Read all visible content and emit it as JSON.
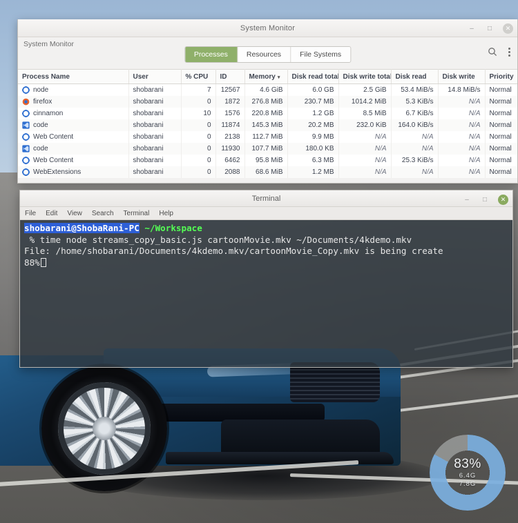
{
  "desktop": {
    "wallpaper_description": "blue-sports-car-on-asphalt"
  },
  "system_monitor": {
    "window_title": "System Monitor",
    "app_name": "System Monitor",
    "window_controls": {
      "minimize": "–",
      "maximize": "□",
      "close": "✕"
    },
    "tabs": [
      {
        "label": "Processes",
        "active": true
      },
      {
        "label": "Resources",
        "active": false
      },
      {
        "label": "File Systems",
        "active": false
      }
    ],
    "actions": {
      "search": "search-icon",
      "menu": "kebab-menu-icon"
    },
    "columns": [
      "Process Name",
      "User",
      "% CPU",
      "ID",
      "Memory",
      "Disk read total",
      "Disk write total",
      "Disk read",
      "Disk write",
      "Priority"
    ],
    "sorted_column": "Memory",
    "sort_caret": "▾",
    "rows": [
      {
        "name": "node",
        "icon": "gear-icon",
        "user": "shobarani",
        "cpu": "7",
        "id": "12567",
        "memory": "4.6 GiB",
        "disk_read_total": "6.0 GB",
        "disk_write_total": "2.5 GiB",
        "disk_read": "53.4 MiB/s",
        "disk_write": "14.8 MiB/s",
        "priority": "Normal"
      },
      {
        "name": "firefox",
        "icon": "firefox-icon",
        "user": "shobarani",
        "cpu": "0",
        "id": "1872",
        "memory": "276.8 MiB",
        "disk_read_total": "230.7 MB",
        "disk_write_total": "1014.2 MiB",
        "disk_read": "5.3 KiB/s",
        "disk_write": "N/A",
        "priority": "Normal"
      },
      {
        "name": "cinnamon",
        "icon": "gear-icon",
        "user": "shobarani",
        "cpu": "10",
        "id": "1576",
        "memory": "220.8 MiB",
        "disk_read_total": "1.2 GB",
        "disk_write_total": "8.5 MiB",
        "disk_read": "6.7 KiB/s",
        "disk_write": "N/A",
        "priority": "Normal"
      },
      {
        "name": "code",
        "icon": "code-icon",
        "user": "shobarani",
        "cpu": "0",
        "id": "11874",
        "memory": "145.3 MiB",
        "disk_read_total": "20.2 MB",
        "disk_write_total": "232.0 KiB",
        "disk_read": "164.0 KiB/s",
        "disk_write": "N/A",
        "priority": "Normal"
      },
      {
        "name": "Web Content",
        "icon": "gear-icon",
        "user": "shobarani",
        "cpu": "0",
        "id": "2138",
        "memory": "112.7 MiB",
        "disk_read_total": "9.9 MB",
        "disk_write_total": "N/A",
        "disk_read": "N/A",
        "disk_write": "N/A",
        "priority": "Normal"
      },
      {
        "name": "code",
        "icon": "code-icon",
        "user": "shobarani",
        "cpu": "0",
        "id": "11930",
        "memory": "107.7 MiB",
        "disk_read_total": "180.0 KB",
        "disk_write_total": "N/A",
        "disk_read": "N/A",
        "disk_write": "N/A",
        "priority": "Normal"
      },
      {
        "name": "Web Content",
        "icon": "gear-icon",
        "user": "shobarani",
        "cpu": "0",
        "id": "6462",
        "memory": "95.8 MiB",
        "disk_read_total": "6.3 MB",
        "disk_write_total": "N/A",
        "disk_read": "25.3 KiB/s",
        "disk_write": "N/A",
        "priority": "Normal"
      },
      {
        "name": "WebExtensions",
        "icon": "gear-icon",
        "user": "shobarani",
        "cpu": "0",
        "id": "2088",
        "memory": "68.6 MiB",
        "disk_read_total": "1.2 MB",
        "disk_write_total": "N/A",
        "disk_read": "N/A",
        "disk_write": "N/A",
        "priority": "Normal"
      }
    ]
  },
  "terminal": {
    "window_title": "Terminal",
    "window_controls": {
      "minimize": "–",
      "maximize": "□",
      "close": "✕"
    },
    "menus": [
      "File",
      "Edit",
      "View",
      "Search",
      "Terminal",
      "Help"
    ],
    "prompt_user": "shobarani@ShobaRani-PC",
    "prompt_path": "~/Workspace",
    "command_line": " % time node streams_copy_basic.js cartoonMovie.mkv ~/Documents/4kdemo.mkv",
    "output_line": "File: /home/shobarani/Documents/4kdemo.mkv/cartoonMovie_Copy.mkv is being create",
    "progress_line": "88%"
  },
  "progress_widget": {
    "percent_label": "83%",
    "current_value": "6.4G",
    "total_value": "7.8G",
    "percent_value": 83,
    "ring_color": "#7cb0e0",
    "track_color": "#c8cdcd"
  }
}
